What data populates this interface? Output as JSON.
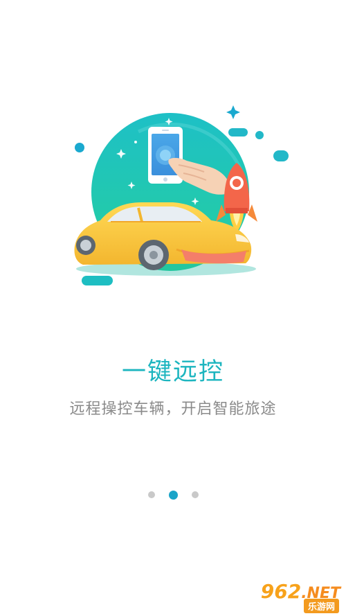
{
  "slide": {
    "title": "一键远控",
    "subtitle": "远程操控车辆，开启智能旅途"
  },
  "pager": {
    "count": 3,
    "active_index": 1
  },
  "watermark": {
    "number": "962",
    "domain": ".NET",
    "label": "乐游网"
  },
  "colors": {
    "title": "#1cb5bf",
    "subtitle": "#8a8a8a",
    "dot_active": "#1aa4c8",
    "dot_inactive": "#c9c9c9",
    "car": "#f8c845",
    "rocket": "#f3664a",
    "circle": "#26c3a6"
  },
  "icons": {
    "illustration": "car-remote-control-illustration"
  }
}
